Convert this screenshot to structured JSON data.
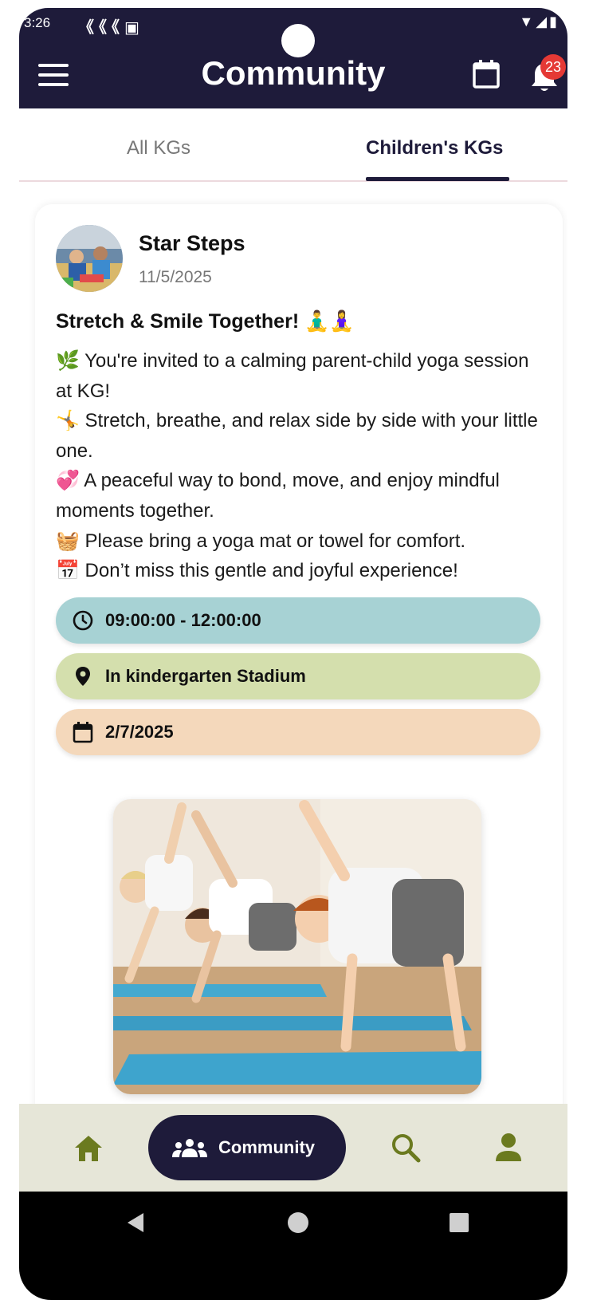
{
  "status_bar": {
    "time": "3:26",
    "notification_icons": "《《《▣",
    "system_icons": "▼◢▮"
  },
  "header": {
    "title": "Community",
    "notification_count": "23"
  },
  "tabs": [
    {
      "label": "All KGs",
      "active": false
    },
    {
      "label": "Children's KGs",
      "active": true
    }
  ],
  "post": {
    "author": "Star Steps",
    "date": "11/5/2025",
    "title": "Stretch & Smile Together! 🧘‍♂️🧘‍♀️",
    "body": [
      "🌿 You're invited to a calming parent-child yoga session at KG!",
      "🤸 Stretch, breathe, and relax side by side with your little one.",
      "💞 A peaceful way to bond, move, and enjoy mindful moments together.",
      "🧺 Please bring a yoga mat or towel for comfort.",
      "📅 Don’t miss this gentle and joyful experience!"
    ],
    "time_range": "09:00:00 - 12:00:00",
    "location": "In kindergarten Stadium",
    "event_date": "2/7/2025"
  },
  "bottom_nav": {
    "community_label": "Community"
  },
  "colors": {
    "primary": "#1e1b3a",
    "nav_bg": "#e6e6d8",
    "nav_icon": "#6b7a1f",
    "pill_time": "#a7d2d4",
    "pill_location": "#d4dfad",
    "pill_date": "#f4d8bb",
    "badge": "#e53935"
  },
  "icons": {
    "menu": "hamburger-icon",
    "calendar": "calendar-icon",
    "bell": "bell-icon",
    "clock": "clock-icon",
    "location": "location-pin-icon",
    "home": "home-icon",
    "community": "people-icon",
    "search": "search-icon",
    "profile": "person-icon"
  }
}
